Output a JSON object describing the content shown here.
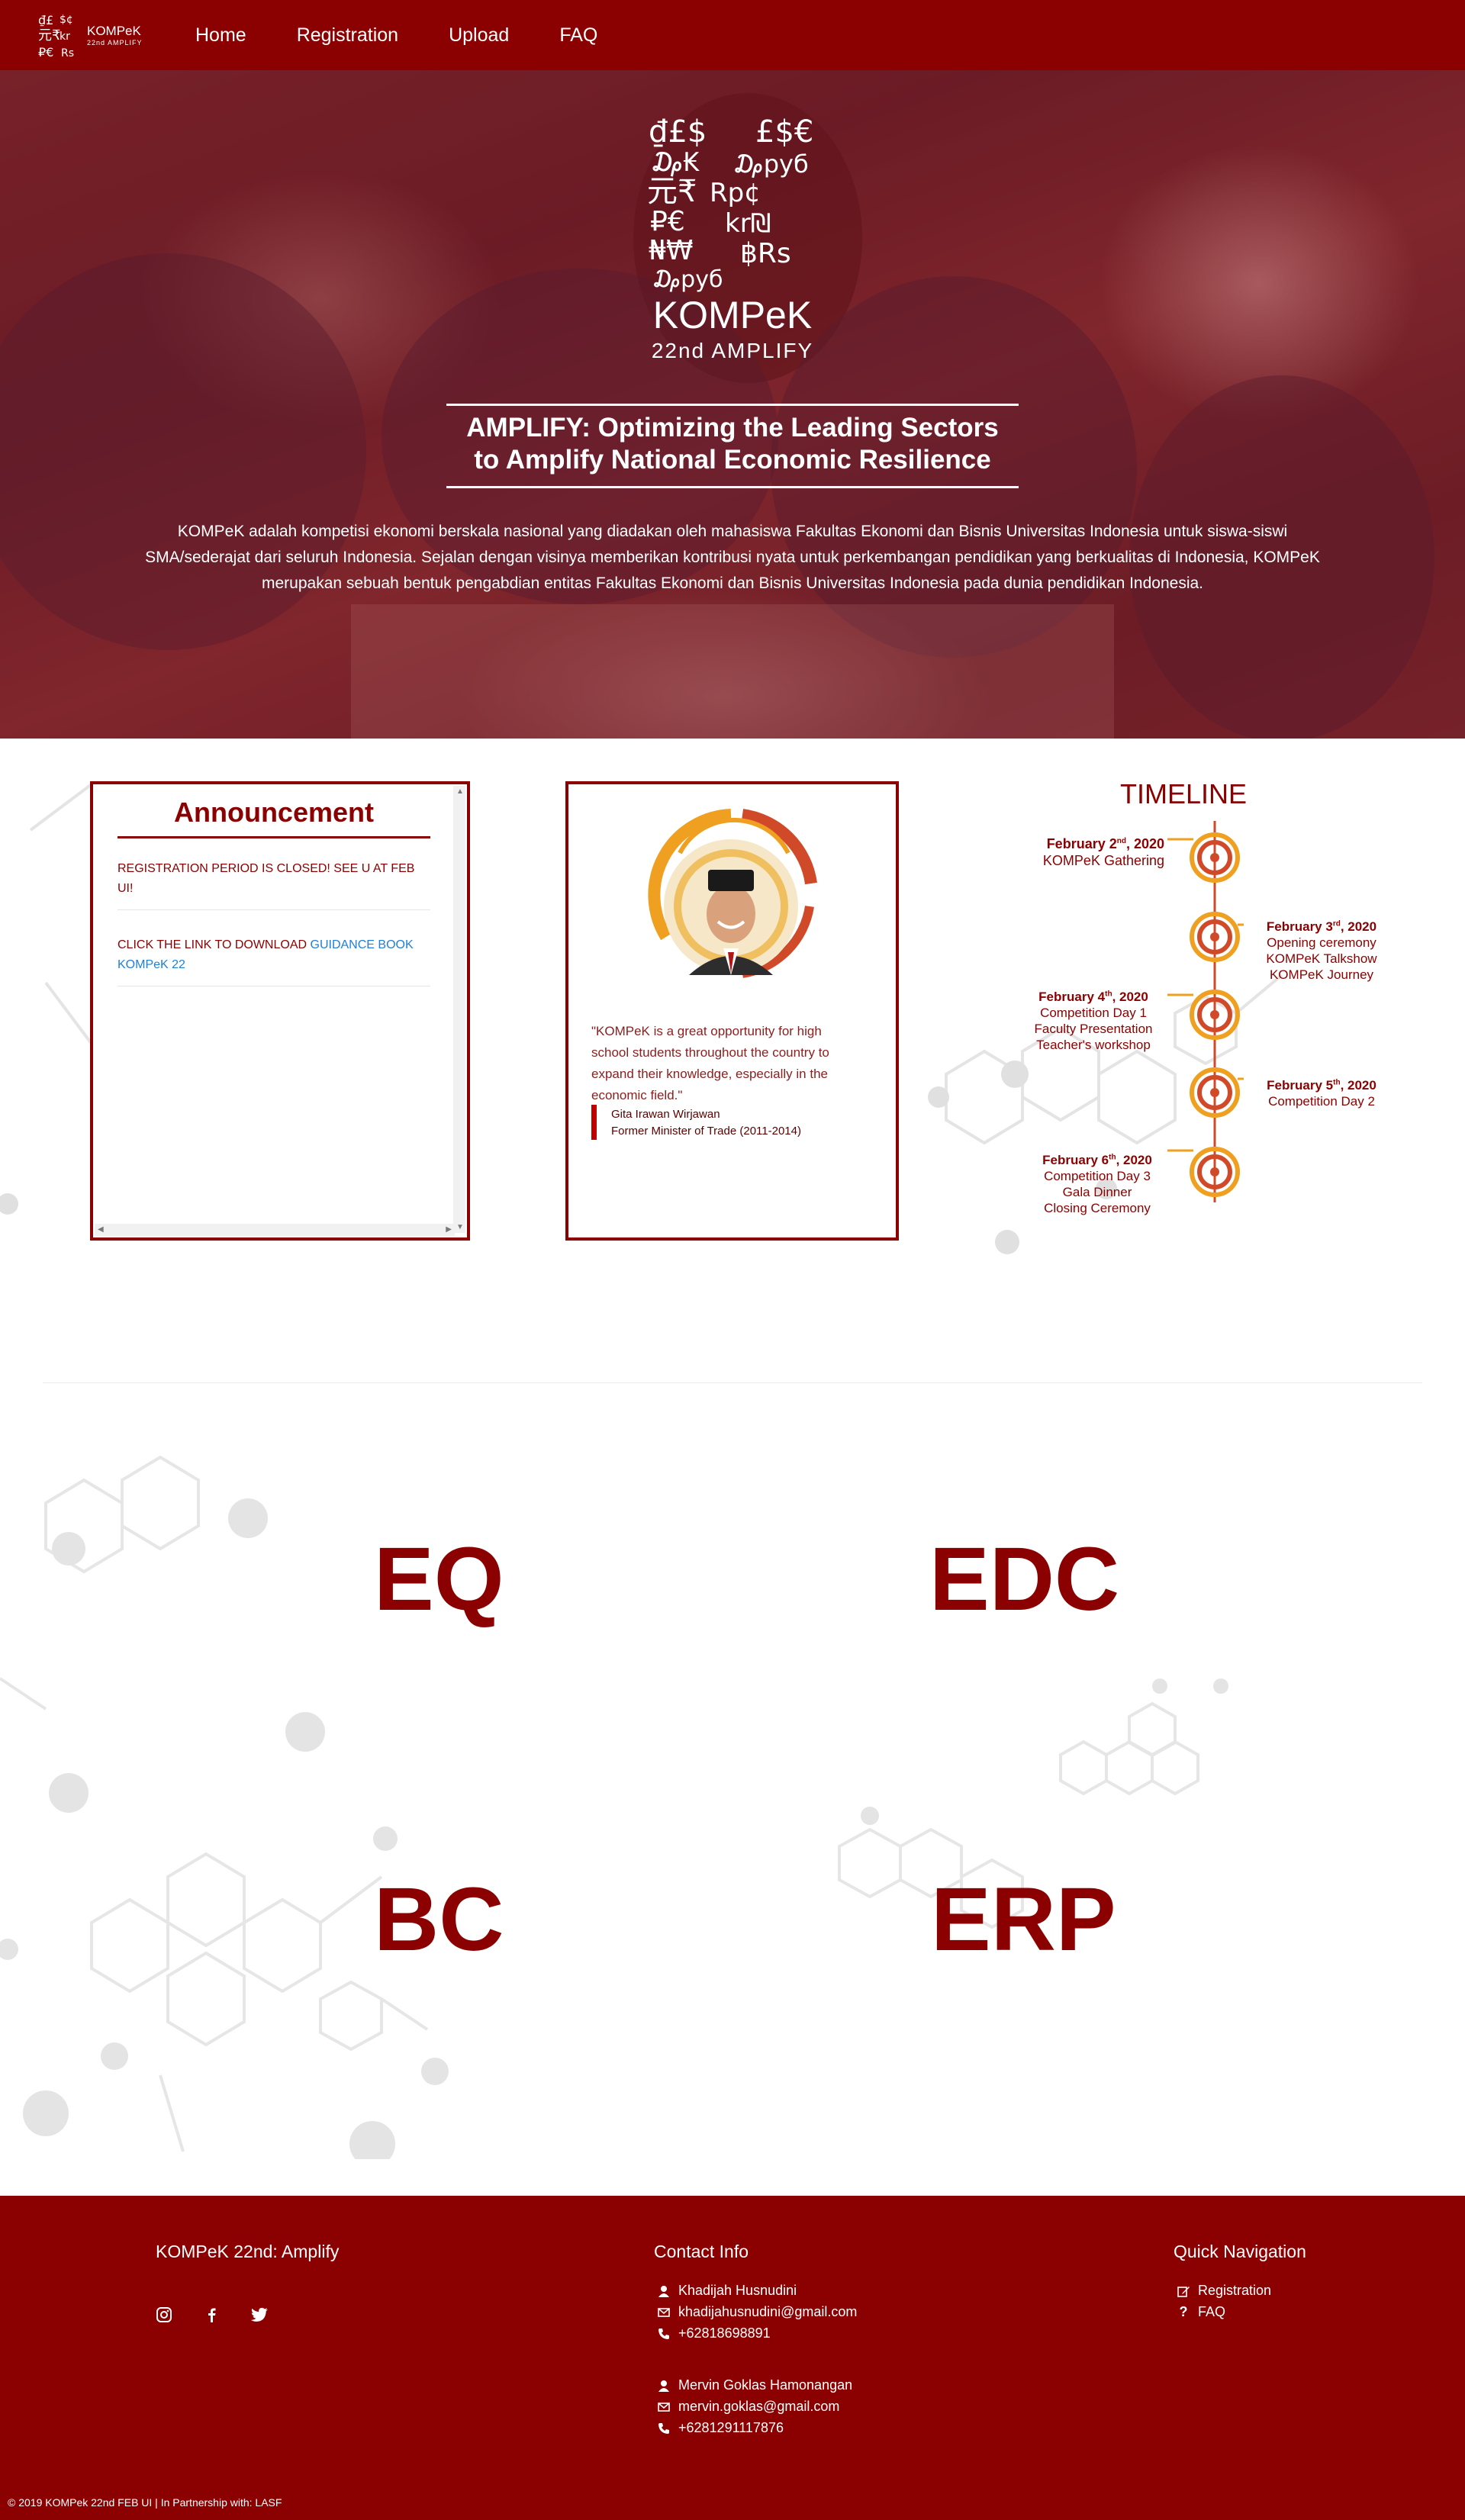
{
  "nav": {
    "brand_line1": "KOMPeK",
    "brand_line2": "22nd AMPLIFY",
    "links": [
      "Home",
      "Registration",
      "Upload",
      "FAQ"
    ]
  },
  "hero": {
    "logo_title": "KOMPeK",
    "logo_subtitle": "22nd AMPLIFY",
    "title_line1": "AMPLIFY: Optimizing the Leading Sectors",
    "title_line2": "to Amplify National Economic Resilience",
    "description": "KOMPeK adalah kompetisi ekonomi berskala nasional yang diadakan oleh mahasiswa Fakultas Ekonomi dan Bisnis Universitas Indonesia untuk siswa-siswi SMA/sederajat dari seluruh Indonesia. Sejalan dengan visinya memberikan kontribusi nyata untuk perkembangan pendidikan yang berkualitas di Indonesia, KOMPeK merupakan sebuah bentuk pengabdian entitas Fakultas Ekonomi dan Bisnis Universitas Indonesia pada dunia pendidikan Indonesia."
  },
  "announcement": {
    "title": "Announcement",
    "item1": "REGISTRATION PERIOD IS CLOSED! SEE U AT FEB UI!",
    "item2_text": "CLICK THE LINK TO DOWNLOAD ",
    "item2_link": "GUIDANCE BOOK KOMPeK 22"
  },
  "testimonial": {
    "quote": "\"KOMPeK is a great opportunity for high school students throughout the country to expand their knowledge, especially in the economic field.\"",
    "name": "Gita Irawan Wirjawan",
    "role": "Former Minister of Trade (2011-2014)"
  },
  "timeline": {
    "title": "TIMELINE",
    "events": [
      {
        "month": "February 2",
        "sup": "nd",
        "year": ", 2020",
        "lines": [
          "KOMPeK Gathering"
        ]
      },
      {
        "month": "February 3",
        "sup": "rd",
        "year": ", 2020",
        "lines": [
          "Opening ceremony",
          "KOMPeK Talkshow",
          "KOMPeK Journey"
        ]
      },
      {
        "month": "February 4",
        "sup": "th",
        "year": ", 2020",
        "lines": [
          "Competition Day 1",
          "Faculty Presentation",
          "Teacher's workshop"
        ]
      },
      {
        "month": "February 5",
        "sup": "th",
        "year": ", 2020",
        "lines": [
          "Competition Day 2"
        ]
      },
      {
        "month": "February 6",
        "sup": "th",
        "year": ", 2020",
        "lines": [
          "Competition Day 3",
          "Gala Dinner",
          "Closing Ceremony"
        ]
      }
    ]
  },
  "competitions": [
    "EQ",
    "EDC",
    "BC",
    "ERP"
  ],
  "footer": {
    "brand": "KOMPeK 22nd: Amplify",
    "contact_title": "Contact Info",
    "contact1_name": "Khadijah Husnudini",
    "contact1_email": "khadijahusnudini@gmail.com",
    "contact1_phone": "+62818698891",
    "contact2_name": "Mervin Goklas Hamonangan",
    "contact2_email": "mervin.goklas@gmail.com",
    "contact2_phone": "+6281291117876",
    "nav_title": "Quick Navigation",
    "nav_registration": "Registration",
    "nav_faq": "FAQ",
    "copyright": "© 2019 KOMPek 22nd FEB UI | In Partnership with: LASF"
  },
  "colors": {
    "primary": "#8b0000",
    "link": "#1e7fd8",
    "accent_orange": "#f0a020",
    "accent_red": "#d04a2a"
  },
  "icons": [
    "instagram-icon",
    "facebook-icon",
    "twitter-icon",
    "user-icon",
    "envelope-icon",
    "phone-icon",
    "edit-icon",
    "question-icon"
  ]
}
